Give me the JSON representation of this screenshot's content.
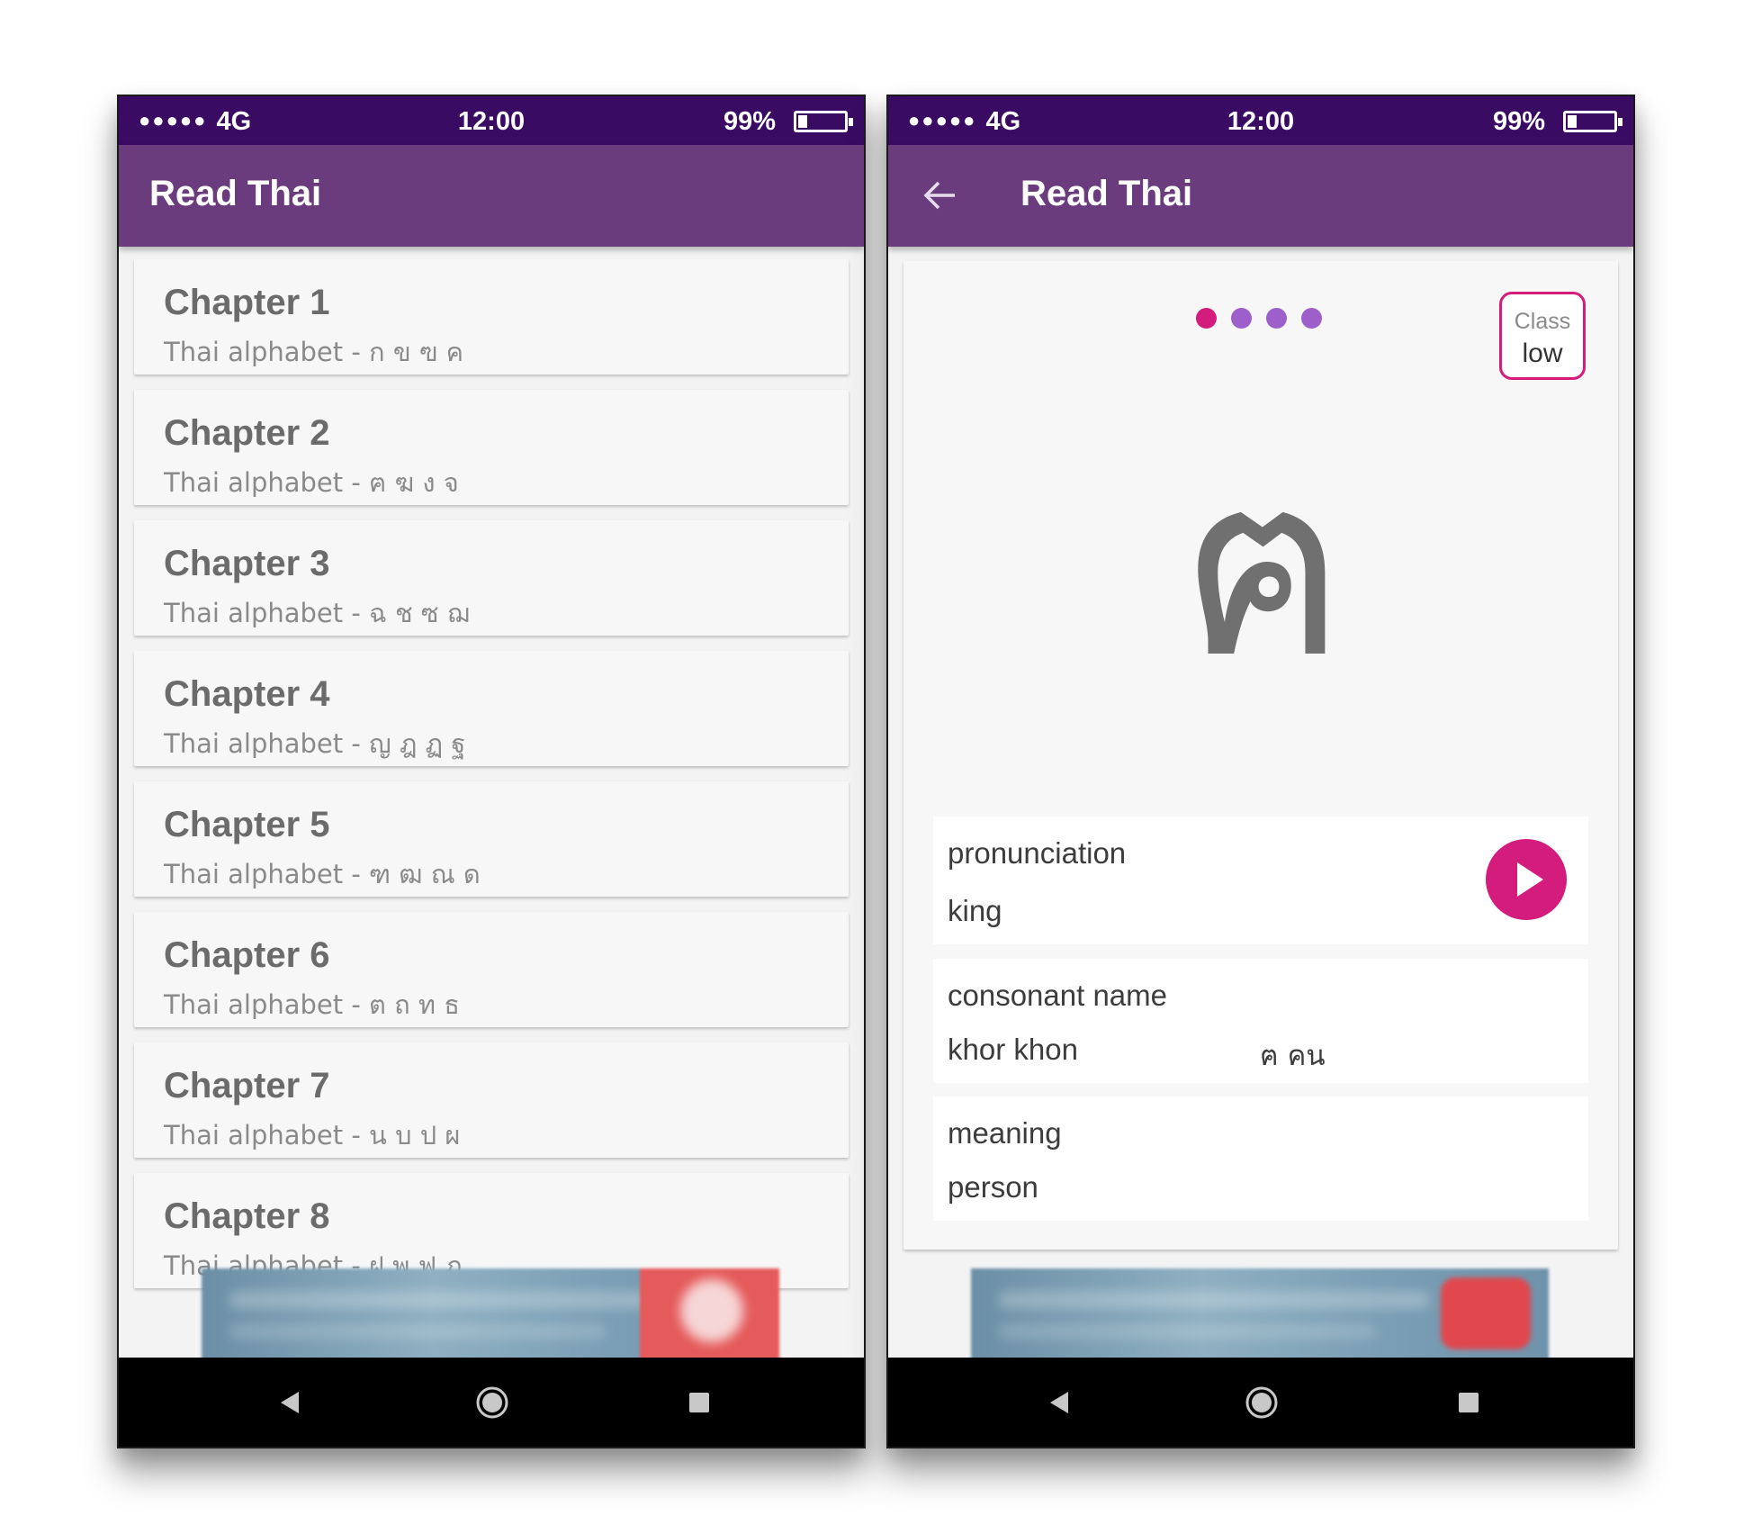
{
  "status": {
    "signal": "●●●●●",
    "network": "4G",
    "time": "12:00",
    "battery": "99%"
  },
  "left_screen": {
    "title": "Read Thai",
    "chapters": [
      {
        "title": "Chapter 1",
        "subtitle": "Thai alphabet - ก ข ฃ ค"
      },
      {
        "title": "Chapter 2",
        "subtitle": "Thai alphabet - ฅ ฆ ง จ"
      },
      {
        "title": "Chapter 3",
        "subtitle": "Thai alphabet - ฉ ช ซ ฌ"
      },
      {
        "title": "Chapter 4",
        "subtitle": "Thai alphabet - ญ ฎ ฏ ฐ"
      },
      {
        "title": "Chapter 5",
        "subtitle": "Thai alphabet - ฑ ฒ ณ ด"
      },
      {
        "title": "Chapter 6",
        "subtitle": "Thai alphabet - ต ถ ท ธ"
      },
      {
        "title": "Chapter 7",
        "subtitle": "Thai alphabet - น บ ป ผ"
      },
      {
        "title": "Chapter 8",
        "subtitle": "Thai alphabet - ฝ พ ฟ ภ"
      }
    ]
  },
  "right_screen": {
    "title": "Read Thai",
    "pager": {
      "count": 4,
      "active": 0
    },
    "class_label": "Class",
    "class_value": "low",
    "letter": "ฅ",
    "pronunciation_label": "pronunciation",
    "pronunciation_value": "king",
    "consonant_label": "consonant name",
    "consonant_value": "khor khon",
    "consonant_thai": "ฅ คน",
    "meaning_label": "meaning",
    "meaning_value": "person"
  },
  "icons": {
    "back_arrow": "arrow-left-icon",
    "play": "play-icon",
    "nav_back": "triangle-back-icon",
    "nav_home": "circle-home-icon",
    "nav_recent": "square-recent-icon"
  },
  "colors": {
    "status_bar": "#3a0b63",
    "app_bar": "#6b3c7d",
    "accent": "#d31c7c",
    "pager_dot": "#9d5fc9"
  }
}
